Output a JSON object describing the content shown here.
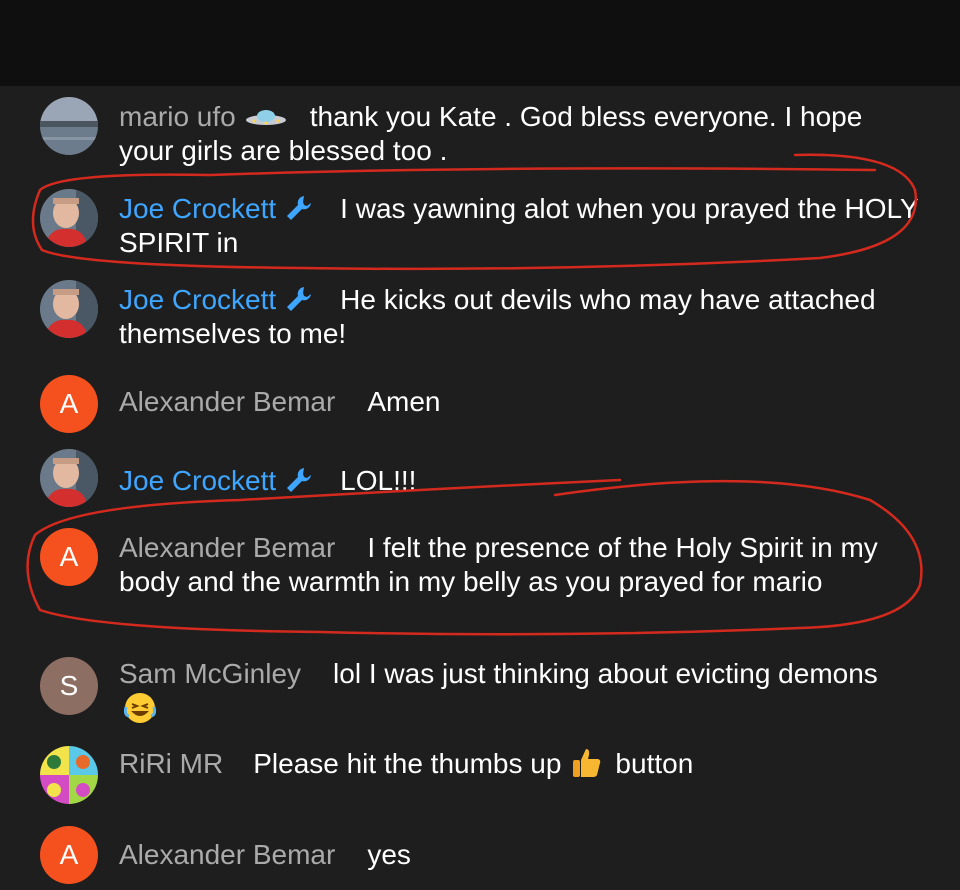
{
  "theme": {
    "background": "#1e1e1e",
    "topbar": "#0f0f0f",
    "owner_name_color": "#3ea6ff",
    "author_color": "#aaaaaa",
    "annotation_color": "#d42a1e"
  },
  "messages": [
    {
      "author": "mario ufo",
      "text": "thank you Kate . God bless everyone. I hope your girls are blessed too .",
      "badge": "ufo-icon",
      "avatar": "lake-photo"
    },
    {
      "author": "Joe Crockett",
      "text": "I was yawning alot when you prayed the HOLY SPIRIT in",
      "badge": "wrench-icon",
      "avatar": "profile-photo"
    },
    {
      "author": "Joe Crockett",
      "text": "He kicks out devils who may have attached themselves to me!",
      "badge": "wrench-icon",
      "avatar": "profile-photo"
    },
    {
      "author": "Alexander Bemar",
      "text": "Amen",
      "avatar_letter": "A",
      "avatar_color": "#f4511e"
    },
    {
      "author": "Joe Crockett",
      "text": "LOL!!!",
      "badge": "wrench-icon",
      "avatar": "profile-photo"
    },
    {
      "author": "Alexander Bemar",
      "text": "I felt the presence of the Holy Spirit in my body and the warmth in my belly as you prayed for mario",
      "avatar_letter": "A",
      "avatar_color": "#f4511e"
    },
    {
      "author": "Sam McGinley",
      "text_before": "lol I was just thinking about evicting demons",
      "emoji": "laughing-emoji",
      "avatar_letter": "S",
      "avatar_color": "#8d6e63"
    },
    {
      "author": "RiRi MR",
      "text_before": "Please hit the thumbs up",
      "emoji": "thumbs-up-emoji",
      "text_after": "button",
      "avatar": "pop-art-photo"
    },
    {
      "author": "Alexander Bemar",
      "text": "yes",
      "avatar_letter": "A",
      "avatar_color": "#f4511e"
    }
  ]
}
